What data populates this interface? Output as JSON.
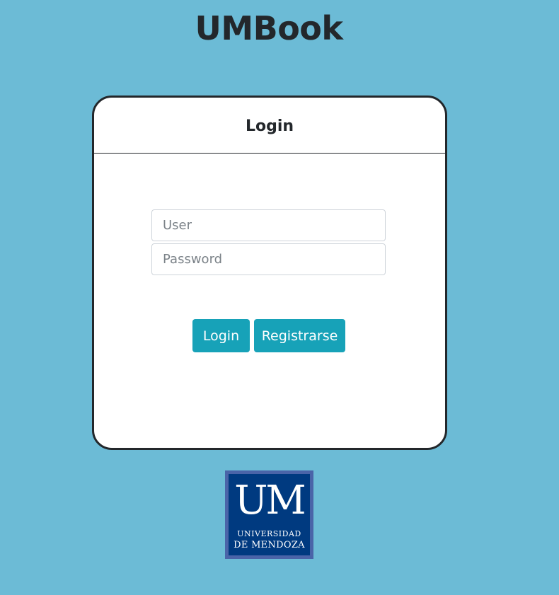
{
  "app": {
    "title": "UMBook"
  },
  "login_card": {
    "title": "Login",
    "user_placeholder": "User",
    "password_placeholder": "Password",
    "login_button": "Login",
    "register_button": "Registrarse"
  },
  "logo": {
    "mark": "UM",
    "line1": "UNIVERSIDAD",
    "line2": "DE MENDOZA"
  },
  "colors": {
    "background": "#6cbbd6",
    "button": "#17a2b8",
    "logo_blue": "#003a80"
  }
}
